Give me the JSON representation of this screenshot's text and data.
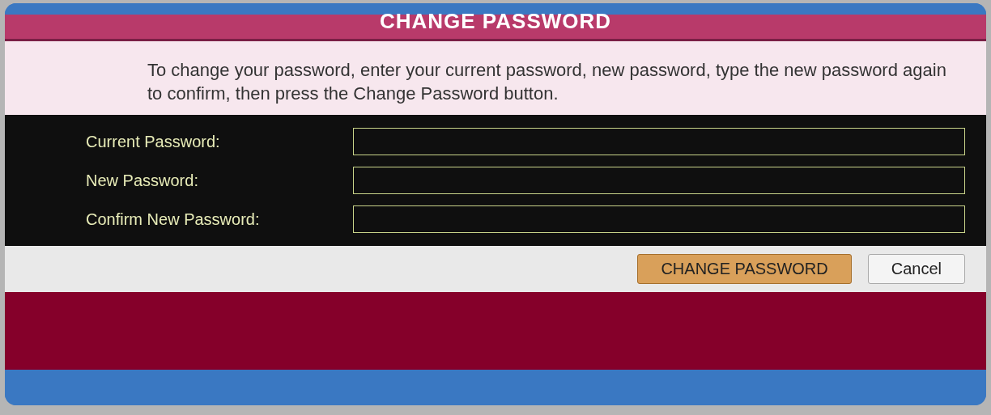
{
  "dialog": {
    "title": "CHANGE PASSWORD",
    "instructions": "To change your password, enter your current password, new password, type the new password again to confirm, then press the Change Password button.",
    "fields": [
      {
        "label": "Current Password:"
      },
      {
        "label": "New Password:"
      },
      {
        "label": "Confirm New Password:"
      }
    ],
    "buttons": [
      {
        "label": "CHANGE PASSWORD",
        "kind": "primary"
      },
      {
        "label": "Cancel",
        "kind": "secondary"
      }
    ]
  }
}
